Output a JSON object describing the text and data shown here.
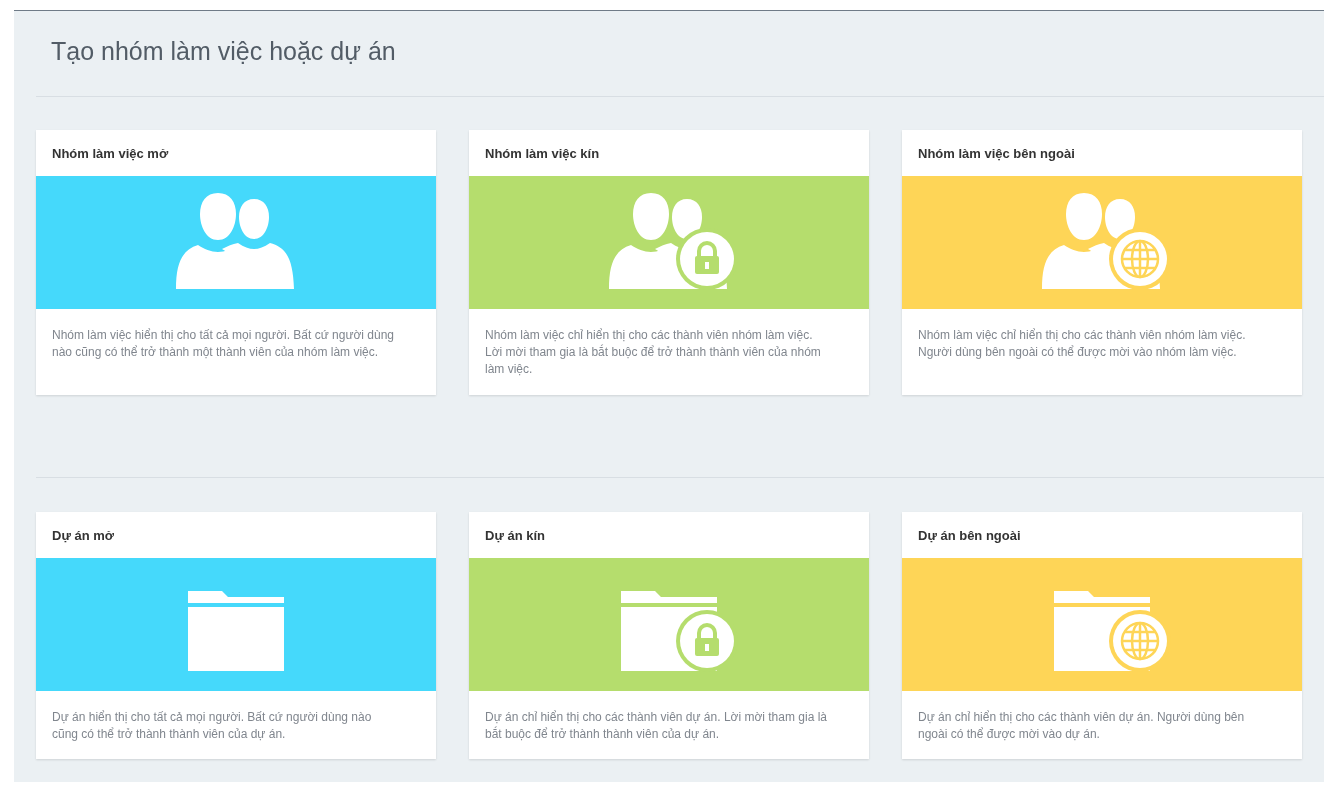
{
  "page": {
    "title": "Tạo nhóm làm việc hoặc dự án"
  },
  "sections": [
    {
      "cards": [
        {
          "title": "Nhóm làm việc mở",
          "kind": "group",
          "locked": false,
          "external": false,
          "color": "#45d9fb",
          "description": "Nhóm làm việc hiển thị cho tất cả mọi người. Bất cứ người dùng nào cũng có thể trở thành một thành viên của nhóm làm việc."
        },
        {
          "title": "Nhóm làm việc kín",
          "kind": "group",
          "locked": true,
          "external": false,
          "color": "#b5dd6d",
          "description": "Nhóm làm việc chỉ hiển thị cho các thành viên nhóm làm việc. Lời mời tham gia là bắt buộc để trở thành thành viên của nhóm làm việc."
        },
        {
          "title": "Nhóm làm việc bên ngoài",
          "kind": "group",
          "locked": false,
          "external": true,
          "color": "#fed557",
          "description": "Nhóm làm việc chỉ hiển thị cho các thành viên nhóm làm việc. Người dùng bên ngoài có thể được mời vào nhóm làm việc."
        }
      ]
    },
    {
      "cards": [
        {
          "title": "Dự án mở",
          "kind": "project",
          "locked": false,
          "external": false,
          "color": "#45d9fb",
          "description": "Dự án hiển thị cho tất cả mọi người. Bất cứ người dùng nào cũng có thể trở thành thành viên của dự án."
        },
        {
          "title": "Dự án kín",
          "kind": "project",
          "locked": true,
          "external": false,
          "color": "#b5dd6d",
          "description": "Dự án chỉ hiển thị cho các thành viên dự án. Lời mời tham gia là bắt buộc để trở thành thành viên của dự án."
        },
        {
          "title": "Dự án bên ngoài",
          "kind": "project",
          "locked": false,
          "external": true,
          "color": "#fed557",
          "description": "Dự án chỉ hiển thị cho các thành viên dự án. Người dùng bên ngoài có thể được mời vào dự án."
        }
      ]
    }
  ]
}
